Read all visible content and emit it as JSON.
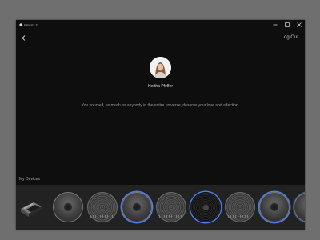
{
  "app": {
    "brand": "EPSELT"
  },
  "header": {
    "logout_label": "Log Out"
  },
  "profile": {
    "name": "Hertha Pfeffer",
    "quote": "You yourself, as much as anybody in the entire universe, deserve your love and affection."
  },
  "devices": {
    "label": "My Devices",
    "items": [
      {
        "kind": "usb-dongle-icon"
      },
      {
        "kind": "speakerphone"
      },
      {
        "kind": "speaker-grille"
      },
      {
        "kind": "speakerphone",
        "selected": true
      },
      {
        "kind": "speaker-grille"
      },
      {
        "kind": "vinyl-disc",
        "selected": true
      },
      {
        "kind": "speaker-grille"
      },
      {
        "kind": "speakerphone",
        "selected": true
      },
      {
        "kind": "speakerphone"
      }
    ]
  },
  "colors": {
    "accent": "#4c7de8",
    "window_bg": "#0e0e0e",
    "strip_bg": "#222222"
  }
}
